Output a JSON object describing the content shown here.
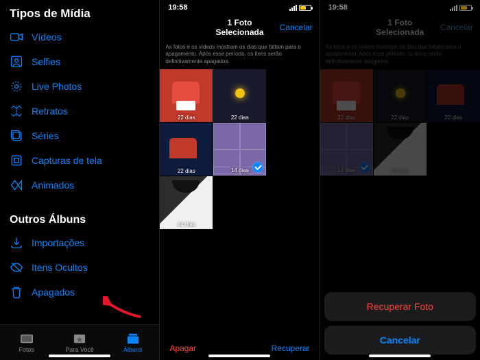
{
  "panel1": {
    "section1_title": "Tipos de Mídia",
    "media_items": [
      {
        "label": "Vídeos",
        "icon": "video-icon"
      },
      {
        "label": "Selfies",
        "icon": "selfie-icon"
      },
      {
        "label": "Live Photos",
        "icon": "live-icon"
      },
      {
        "label": "Retratos",
        "icon": "portrait-icon"
      },
      {
        "label": "Séries",
        "icon": "burst-icon"
      },
      {
        "label": "Capturas de tela",
        "icon": "screenshot-icon"
      },
      {
        "label": "Animados",
        "icon": "animated-icon"
      }
    ],
    "section2_title": "Outros Álbuns",
    "other_items": [
      {
        "label": "Importações",
        "icon": "import-icon"
      },
      {
        "label": "Itens Ocultos",
        "icon": "hidden-icon"
      },
      {
        "label": "Apagados",
        "icon": "trash-icon"
      }
    ],
    "tabs": [
      {
        "label": "Fotos"
      },
      {
        "label": "Para Você"
      },
      {
        "label": "Álbuns"
      }
    ]
  },
  "panel2": {
    "time": "19:58",
    "title": "1 Foto Selecionada",
    "cancel": "Cancelar",
    "subtitle": "As fotos e os vídeos mostram os dias que faltam para o apagamento. Após esse período, os itens serão definitivamente apagados.",
    "thumbs": [
      {
        "days": "22 dias"
      },
      {
        "days": "22 dias"
      },
      {
        "days": "22 dias"
      },
      {
        "days": "14 dias",
        "selected": true
      },
      {
        "days": "14 dias"
      }
    ],
    "delete_label": "Apagar",
    "recover_label": "Recuperar"
  },
  "panel3": {
    "time": "19:58",
    "title": "1 Foto Selecionada",
    "cancel": "Cancelar",
    "subtitle": "As fotos e os vídeos mostram os dias que faltam para o apagamento. Após esse período, os itens serão definitivamente apagados.",
    "sheet_recover": "Recuperar Foto",
    "sheet_cancel": "Cancelar"
  }
}
